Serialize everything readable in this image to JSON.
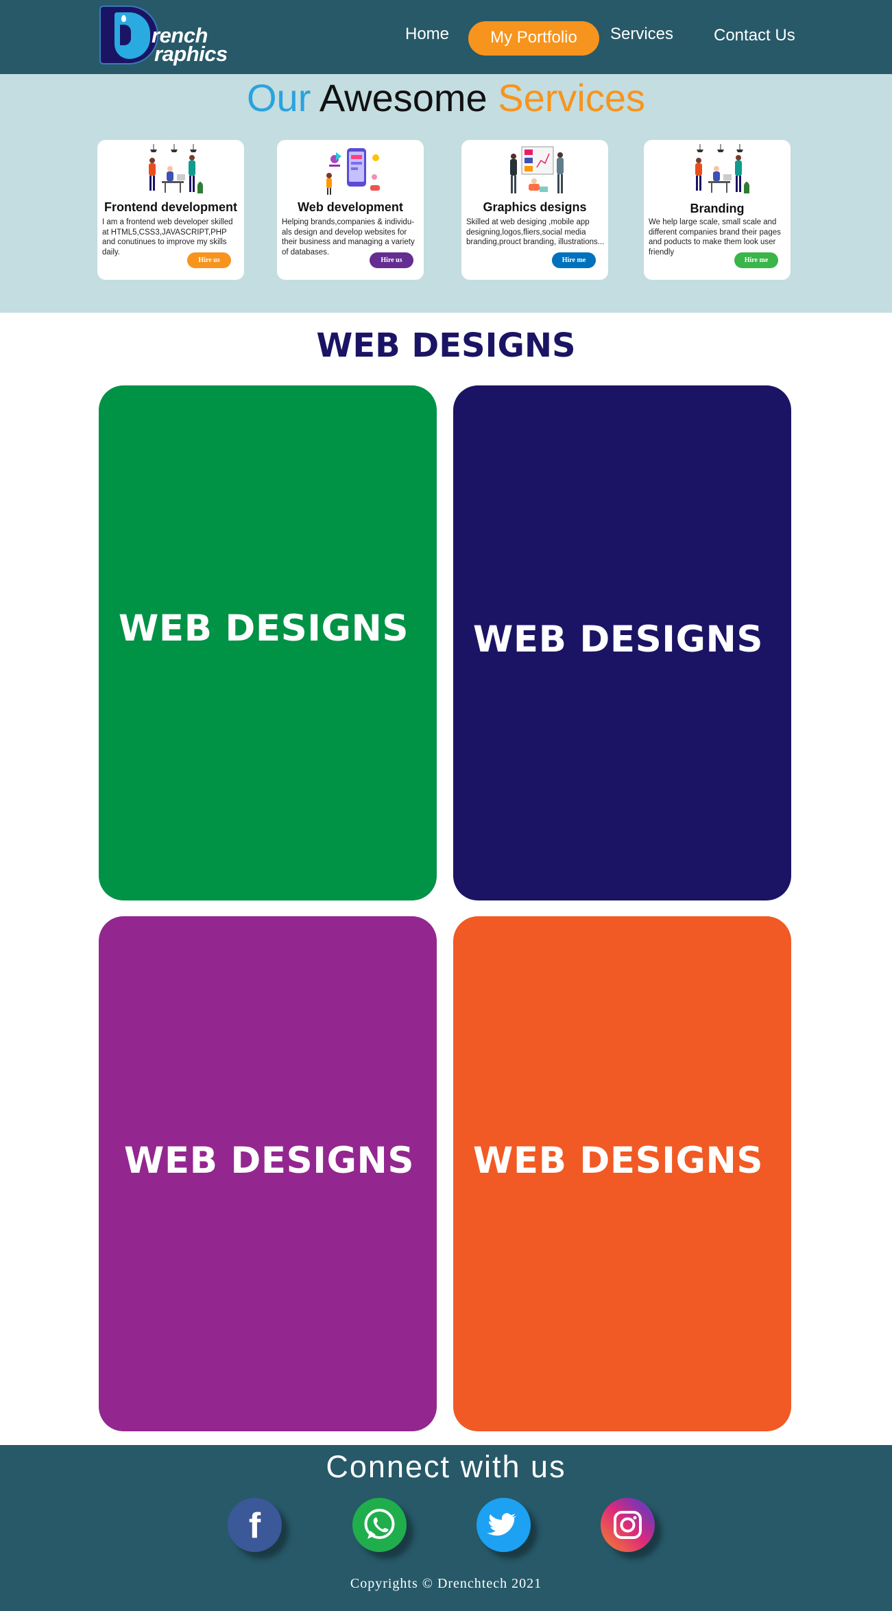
{
  "brand": {
    "line1": "rench",
    "line2": "raphics"
  },
  "nav": {
    "home": "Home",
    "portfolio": "My Portfolio",
    "services": "Services",
    "contact": "Contact Us"
  },
  "services_section": {
    "title_part1": "Our",
    "title_part2": "Awesome",
    "title_part3": "Services",
    "cards": [
      {
        "title": "Frontend development",
        "description": "I am a frontend web developer skilled at HTML5,CSS3,JAVASCRIPT,PHP and conutinues to improve my skills daily.",
        "button": "Hire us",
        "button_color": "#f7941d"
      },
      {
        "title": "Web development",
        "description": "Helping brands,companies & individu-als design and develop websites for their business and managing a variety of databases.",
        "button": "Hire us",
        "button_color": "#662d91"
      },
      {
        "title": "Graphics designs",
        "description": "Skilled at web desiging ,mobile app designing,logos,fliers,social media branding,prouct branding, illustrations...",
        "button": "Hire me",
        "button_color": "#0071bc"
      },
      {
        "title": "Branding",
        "description": "We help large scale, small scale and different companies brand their pages and poducts to make them look user friendly",
        "button": "Hire me",
        "button_color": "#39b54a"
      }
    ]
  },
  "web_designs": {
    "heading": "WEB DESIGNS",
    "cards": [
      {
        "label": "WEB DESIGNS",
        "color": "#009245"
      },
      {
        "label": "WEB DESIGNS",
        "color": "#1b1464"
      },
      {
        "label": "WEB DESIGNS",
        "color": "#93278f"
      },
      {
        "label": "WEB DESIGNS",
        "color": "#f15a24"
      }
    ]
  },
  "footer": {
    "connect": "Connect with us",
    "social": [
      "facebook-icon",
      "whatsapp-icon",
      "twitter-icon",
      "instagram-icon"
    ],
    "copyright": "Copyrights © Drenchtech 2021"
  },
  "colors": {
    "header_bg": "#275968",
    "services_bg": "#c3dde0",
    "accent_orange": "#f7941d",
    "accent_blue": "#29a3dd",
    "navy": "#1b1464"
  }
}
